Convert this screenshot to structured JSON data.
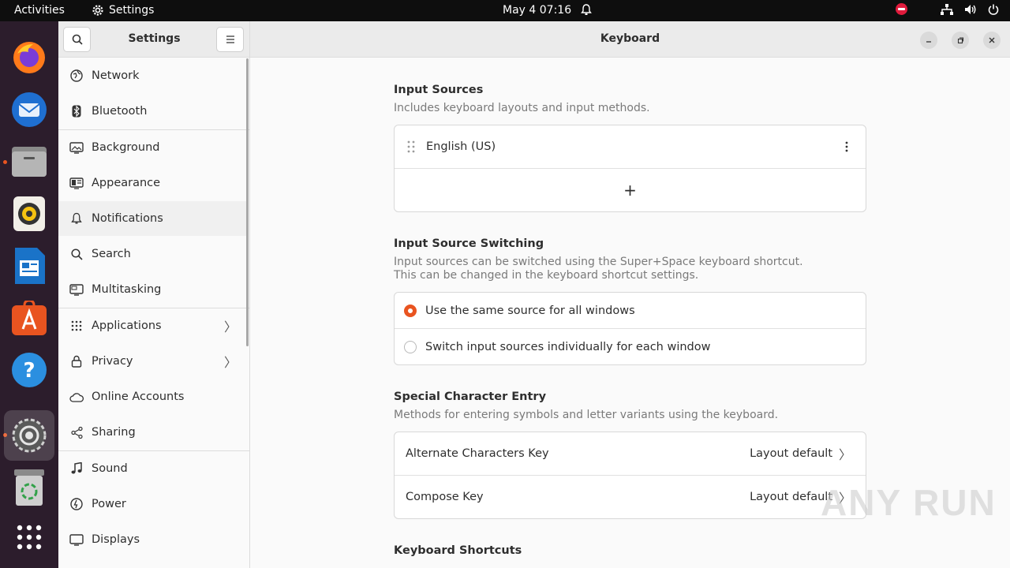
{
  "topbar": {
    "activities": "Activities",
    "app_name": "Settings",
    "clock": "May 4  07:16"
  },
  "dock": {
    "items": [
      "firefox-icon",
      "thunderbird-icon",
      "files-icon",
      "rhythmbox-icon",
      "writer-icon",
      "app-center-icon",
      "help-icon",
      "settings-icon",
      "trash-icon",
      "show-apps-icon"
    ]
  },
  "sidebar": {
    "title": "Settings",
    "items": [
      {
        "label": "Network",
        "icon": "network-icon"
      },
      {
        "label": "Bluetooth",
        "icon": "bluetooth-icon"
      },
      {
        "label": "Background",
        "icon": "background-icon"
      },
      {
        "label": "Appearance",
        "icon": "appearance-icon"
      },
      {
        "label": "Notifications",
        "icon": "bell-icon"
      },
      {
        "label": "Search",
        "icon": "search-icon"
      },
      {
        "label": "Multitasking",
        "icon": "multitasking-icon"
      },
      {
        "label": "Applications",
        "icon": "apps-grid-icon"
      },
      {
        "label": "Privacy",
        "icon": "lock-icon"
      },
      {
        "label": "Online Accounts",
        "icon": "cloud-icon"
      },
      {
        "label": "Sharing",
        "icon": "share-icon"
      },
      {
        "label": "Sound",
        "icon": "music-note-icon"
      },
      {
        "label": "Power",
        "icon": "power-icon"
      },
      {
        "label": "Displays",
        "icon": "display-icon"
      }
    ]
  },
  "main": {
    "title": "Keyboard",
    "input_sources": {
      "title": "Input Sources",
      "desc": "Includes keyboard layouts and input methods.",
      "source": "English (US)",
      "add": "+"
    },
    "switching": {
      "title": "Input Source Switching",
      "desc_line1": "Input sources can be switched using the Super+Space keyboard shortcut.",
      "desc_line2": "This can be changed in the keyboard shortcut settings.",
      "option_same": "Use the same source for all windows",
      "option_individual": "Switch input sources individually for each window",
      "selected": "same"
    },
    "special": {
      "title": "Special Character Entry",
      "desc": "Methods for entering symbols and letter variants using the keyboard.",
      "alt_label": "Alternate Characters Key",
      "alt_value": "Layout default",
      "compose_label": "Compose Key",
      "compose_value": "Layout default"
    },
    "shortcuts": {
      "title": "Keyboard Shortcuts"
    }
  },
  "colors": {
    "accent": "#e95420",
    "dock_bg": "#2c1d2c",
    "topbar_bg": "#0e0e0e"
  },
  "watermark": "ANY RUN"
}
